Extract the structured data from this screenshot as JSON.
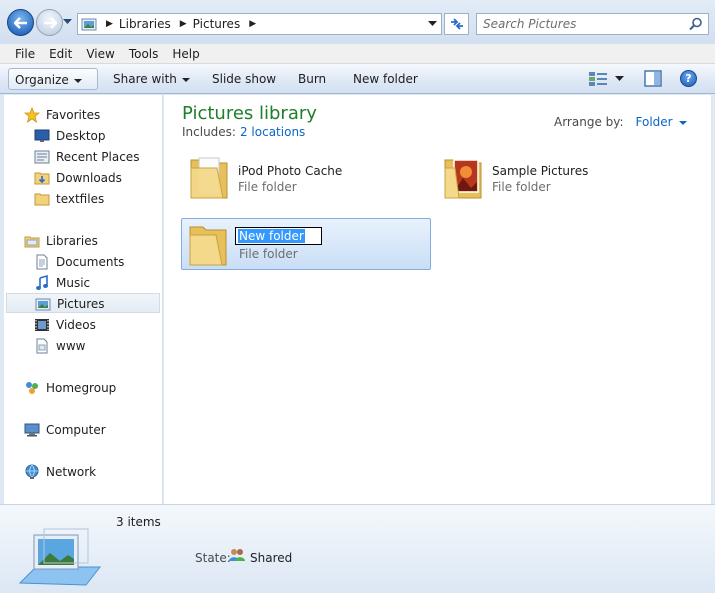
{
  "address": {
    "crumbs": [
      "Libraries",
      "Pictures"
    ]
  },
  "search": {
    "placeholder": "Search Pictures"
  },
  "menu": [
    "File",
    "Edit",
    "View",
    "Tools",
    "Help"
  ],
  "toolbar": {
    "organize": "Organize",
    "share_with": "Share with",
    "slide_show": "Slide show",
    "burn": "Burn",
    "new_folder": "New folder",
    "help_glyph": "?"
  },
  "nav": {
    "favorites": "Favorites",
    "favorites_items": [
      "Desktop",
      "Recent Places",
      "Downloads",
      "textfiles"
    ],
    "libraries": "Libraries",
    "libraries_items": [
      "Documents",
      "Music",
      "Pictures",
      "Videos",
      "www"
    ],
    "selected": "Pictures",
    "homegroup": "Homegroup",
    "computer": "Computer",
    "network": "Network"
  },
  "library": {
    "title": "Pictures library",
    "includes_label": "Includes:",
    "includes_link": "2 locations",
    "arrange_label": "Arrange by:",
    "arrange_value": "Folder"
  },
  "items": [
    {
      "name": "iPod Photo Cache",
      "type": "File folder"
    },
    {
      "name": "Sample Pictures",
      "type": "File folder"
    },
    {
      "name": "New folder",
      "type": "File folder",
      "renaming": true
    }
  ],
  "details": {
    "count": "3 items",
    "state_label": "State:",
    "state_value": "Shared"
  },
  "colors": {
    "library_title": "#1e7f2b",
    "link": "#0b66c8",
    "selection": "#3399ff"
  }
}
